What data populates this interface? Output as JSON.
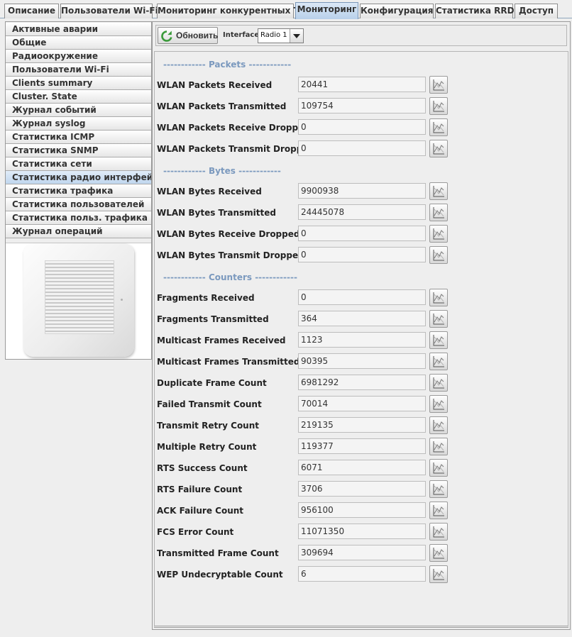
{
  "tabs": [
    {
      "label": "Описание"
    },
    {
      "label": "Пользователи Wi-Fi"
    },
    {
      "label": "Мониторинг конкурентных ТД"
    },
    {
      "label": "Мониторинг",
      "active": true
    },
    {
      "label": "Конфигурация"
    },
    {
      "label": "Статистика RRD"
    },
    {
      "label": "Доступ"
    }
  ],
  "sidebar": {
    "items": [
      {
        "label": "Активные аварии"
      },
      {
        "label": "Общие"
      },
      {
        "label": "Радиоокружение"
      },
      {
        "label": "Пользователи Wi-Fi"
      },
      {
        "label": "Clients summary"
      },
      {
        "label": "Cluster. State"
      },
      {
        "label": "Журнал событий"
      },
      {
        "label": "Журнал syslog"
      },
      {
        "label": "Статистика ICMP"
      },
      {
        "label": "Статистика SNMP"
      },
      {
        "label": "Статистика сети"
      },
      {
        "label": "Статистика радио интерфейсов",
        "active": true
      },
      {
        "label": "Статистика трафика"
      },
      {
        "label": "Статистика пользователей"
      },
      {
        "label": "Статистика польз. трафика"
      },
      {
        "label": "Журнал операций"
      }
    ]
  },
  "toolbar": {
    "refresh_label": "Обновить",
    "interface_label": "Interface",
    "interface_value": "Radio 1"
  },
  "sections": [
    {
      "title": "------------ Packets ------------",
      "rows": [
        {
          "label": "WLAN Packets Received",
          "value": "20441"
        },
        {
          "label": "WLAN Packets Transmitted",
          "value": "109754"
        },
        {
          "label": "WLAN Packets Receive Dropped",
          "value": "0"
        },
        {
          "label": "WLAN Packets Transmit Dropped",
          "value": "0"
        }
      ]
    },
    {
      "title": "------------ Bytes ------------",
      "rows": [
        {
          "label": "WLAN Bytes Received",
          "value": "9900938"
        },
        {
          "label": "WLAN Bytes Transmitted",
          "value": "24445078"
        },
        {
          "label": "WLAN Bytes Receive Dropped",
          "value": "0"
        },
        {
          "label": "WLAN Bytes Transmit Dropped",
          "value": "0"
        }
      ]
    },
    {
      "title": "------------ Counters ------------",
      "rows": [
        {
          "label": "Fragments Received",
          "value": "0"
        },
        {
          "label": "Fragments Transmitted",
          "value": "364"
        },
        {
          "label": "Multicast Frames Received",
          "value": "1123"
        },
        {
          "label": "Multicast Frames Transmitted",
          "value": "90395"
        },
        {
          "label": "Duplicate Frame Count",
          "value": "6981292"
        },
        {
          "label": "Failed Transmit Count",
          "value": "70014"
        },
        {
          "label": "Transmit Retry Count",
          "value": "219135"
        },
        {
          "label": "Multiple Retry Count",
          "value": "119377"
        },
        {
          "label": "RTS Success Count",
          "value": "6071"
        },
        {
          "label": "RTS Failure Count",
          "value": "3706"
        },
        {
          "label": "ACK Failure Count",
          "value": "956100"
        },
        {
          "label": "FCS Error Count",
          "value": "11071350"
        },
        {
          "label": "Transmitted Frame Count",
          "value": "309694"
        },
        {
          "label": "WEP Undecryptable Count",
          "value": "6"
        }
      ]
    }
  ],
  "icons": {
    "refresh": "refresh-icon",
    "chart": "chart-icon",
    "dropdown": "chevron-down-icon"
  },
  "colors": {
    "section_title": "#7b99be",
    "active_tab": "#b8d0ea",
    "refresh_icon": "#3a9a3a"
  }
}
